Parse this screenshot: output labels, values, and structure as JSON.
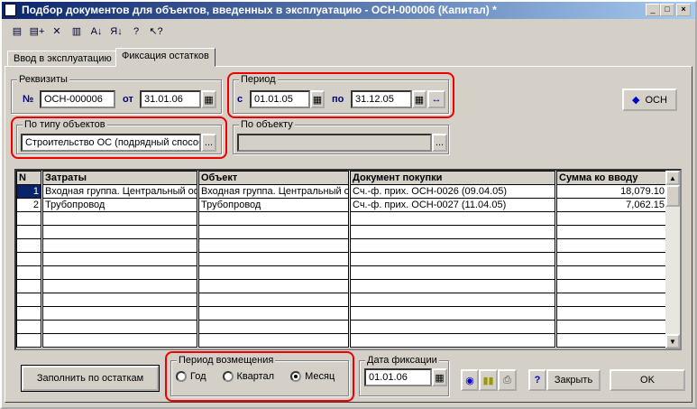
{
  "window": {
    "title": "Подбор документов для объектов, введенных в эксплуатацию - ОСН-000006 (Капитал) *",
    "min": "_",
    "max": "□",
    "close": "×"
  },
  "toolbar": [
    "new-row-icon",
    "add-row-icon",
    "delete-row-icon",
    "copy-row-icon",
    "sort-asc-icon",
    "sort-desc-icon",
    "help-icon",
    "context-help-icon"
  ],
  "tabs": [
    {
      "label": "Ввод в эксплуатацию",
      "active": false
    },
    {
      "label": "Фиксация остатков",
      "active": true
    }
  ],
  "rekvizity": {
    "title": "Реквизиты",
    "num_label": "№",
    "num": "ОСН-000006",
    "date_label": "от",
    "date": "31.01.06"
  },
  "period": {
    "title": "Период",
    "from_label": "с",
    "from": "01.01.05",
    "to_label": "по",
    "to": "31.12.05"
  },
  "osn_button": "ОСН",
  "by_type": {
    "title": "По типу объектов",
    "value": "Строительство ОС (подрядный способ)"
  },
  "by_object": {
    "title": "По объекту",
    "value": ""
  },
  "grid": {
    "columns": [
      "N",
      "Затраты",
      "Объект",
      "Документ покупки",
      "Сумма ко вводу"
    ],
    "rows": [
      [
        "1",
        "Входная группа. Центральный офис",
        "Входная группа. Центральный офис",
        "Сч.-ф. прих. ОСН-0026 (09.04.05)",
        "18,079.10"
      ],
      [
        "2",
        "Трубопровод",
        "Трубопровод",
        "Сч.-ф. прих. ОСН-0027 (11.04.05)",
        "7,062.15"
      ]
    ],
    "empty_rows": 10
  },
  "fill_button": "Заполнить по остаткам",
  "refund_period": {
    "title": "Период возмещения",
    "options": [
      "Год",
      "Квартал",
      "Месяц"
    ],
    "selected": "Месяц"
  },
  "fix_date": {
    "title": "Дата фиксации",
    "value": "01.01.06"
  },
  "close_button": "Закрыть",
  "ok_button": "OK"
}
